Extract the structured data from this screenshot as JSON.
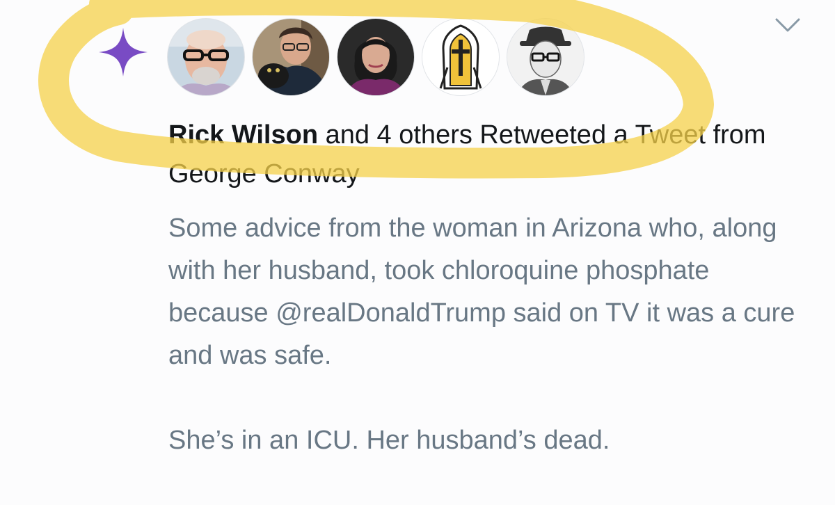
{
  "notification": {
    "actor_name": "Rick Wilson",
    "context_rest": " and 4 others Retweeted a Tweet from George Conway",
    "tweet_text": "Some advice from the woman in Arizona who, along with her husband, took chloroquine phosphate because @realDonaldTrump said on TV it was a cure and was safe.\n\nShe’s in an ICU.  Her husband’s dead.",
    "avatars": [
      {
        "name": "avatar-1",
        "bg": "#c7d3dc"
      },
      {
        "name": "avatar-2",
        "bg": "#8a7c6a"
      },
      {
        "name": "avatar-3",
        "bg": "#2b2b2b"
      },
      {
        "name": "avatar-4",
        "bg": "#ffffff"
      },
      {
        "name": "avatar-5",
        "bg": "#f2f2f2"
      }
    ]
  },
  "colors": {
    "sparkle": "#794bc4",
    "highlight": "#f6d24a",
    "primary_text": "#14171a",
    "secondary_text": "#687784"
  },
  "icons": {
    "sparkle": "sparkle-icon",
    "chevron": "chevron-down-icon"
  }
}
